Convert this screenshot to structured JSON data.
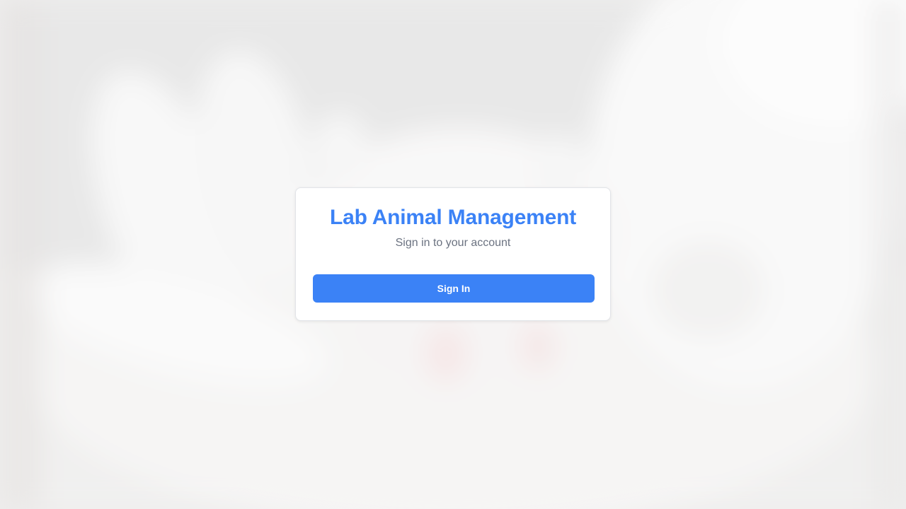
{
  "login": {
    "title": "Lab Animal Management",
    "subtitle": "Sign in to your account",
    "sign_in_label": "Sign In"
  },
  "colors": {
    "accent": "#3b82f6",
    "subtitle_text": "#6b7280",
    "card_background": "#ffffff"
  },
  "background": {
    "image_subject": "blurred photo of a white lab mouse held in a gloved hand"
  }
}
